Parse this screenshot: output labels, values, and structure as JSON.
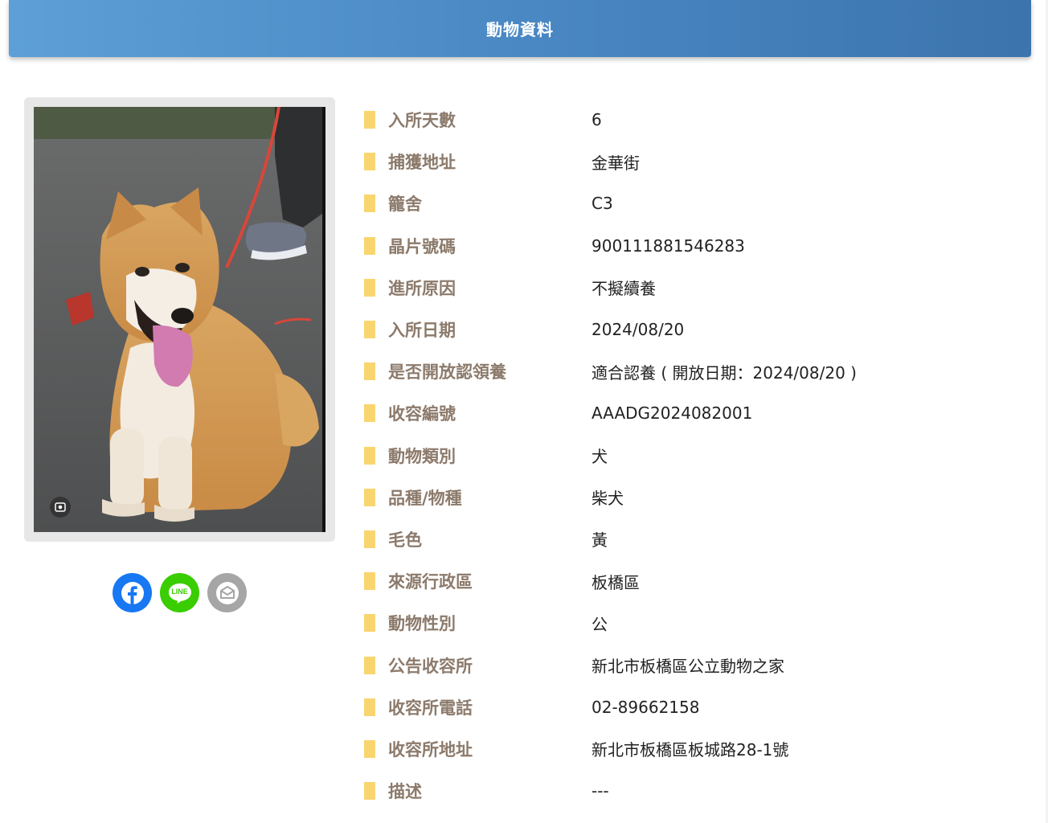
{
  "header": {
    "title": "動物資料"
  },
  "photo": {
    "subject": "shiba-dog-photo"
  },
  "share": {
    "facebook_icon": "facebook-icon",
    "line_label": "LINE",
    "mail_icon": "mail-icon",
    "colors": {
      "facebook": "#1877f2",
      "line": "#3acd01",
      "mail": "#a6a6a6"
    }
  },
  "details": {
    "rows": [
      {
        "label": "入所天數",
        "value": "6"
      },
      {
        "label": "捕獲地址",
        "value": "金華街"
      },
      {
        "label": "籠舍",
        "value": "C3"
      },
      {
        "label": "晶片號碼",
        "value": "900111881546283"
      },
      {
        "label": "進所原因",
        "value": "不擬續養"
      },
      {
        "label": "入所日期",
        "value": "2024/08/20"
      },
      {
        "label": "是否開放認領養",
        "value": "適合認養 ( 開放日期：2024/08/20 )"
      },
      {
        "label": "收容編號",
        "value": "AAADG2024082001"
      },
      {
        "label": "動物類別",
        "value": "犬"
      },
      {
        "label": "品種/物種",
        "value": "柴犬"
      },
      {
        "label": "毛色",
        "value": "黃"
      },
      {
        "label": "來源行政區",
        "value": "板橋區"
      },
      {
        "label": "動物性別",
        "value": "公"
      },
      {
        "label": "公告收容所",
        "value": "新北市板橋區公立動物之家"
      },
      {
        "label": "收容所電話",
        "value": "02-89662158"
      },
      {
        "label": "收容所地址",
        "value": "新北市板橋區板城路28-1號"
      },
      {
        "label": "描述",
        "value": "---"
      }
    ]
  },
  "colors": {
    "header_start": "#5d9fd6",
    "header_end": "#3c74ad",
    "marker": "#f9d56f",
    "label": "#8c7a6b"
  }
}
